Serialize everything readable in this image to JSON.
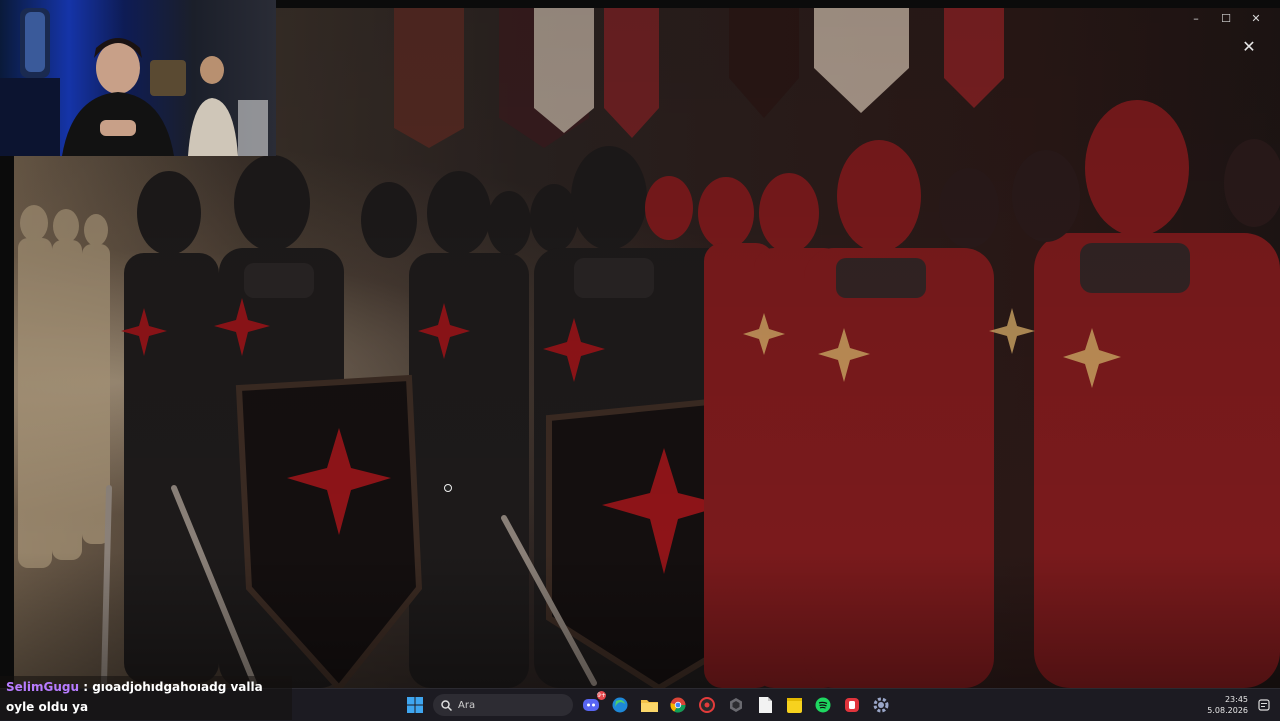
{
  "window": {
    "controls": {
      "minimize": "–",
      "maximize": "☐",
      "close": "✕"
    },
    "viewer_close": "✕"
  },
  "chat": {
    "username": "SelimGugu",
    "separator": " : ",
    "message": "gıoadjohıdgahoıadg valla oyle oldu ya"
  },
  "taskbar": {
    "search_placeholder": "Ara",
    "discord_badge": "9+",
    "apps": [
      "start-icon",
      "search-icon",
      "discord-icon",
      "edge-icon",
      "file-explorer-icon",
      "chrome-icon",
      "app-red-icon",
      "app-hex-icon",
      "file-icon",
      "sticky-notes-icon",
      "spotify-icon",
      "app-pink-icon",
      "settings-icon"
    ],
    "time": "23:45",
    "date": "5.08.2026"
  },
  "colors": {
    "taskbar_bg": "#1c1b22",
    "chat_username": "#b87cff",
    "accent_blue": "#1534a8",
    "armor_red": "#7a1a1c",
    "armor_black": "#1d1a1a"
  }
}
